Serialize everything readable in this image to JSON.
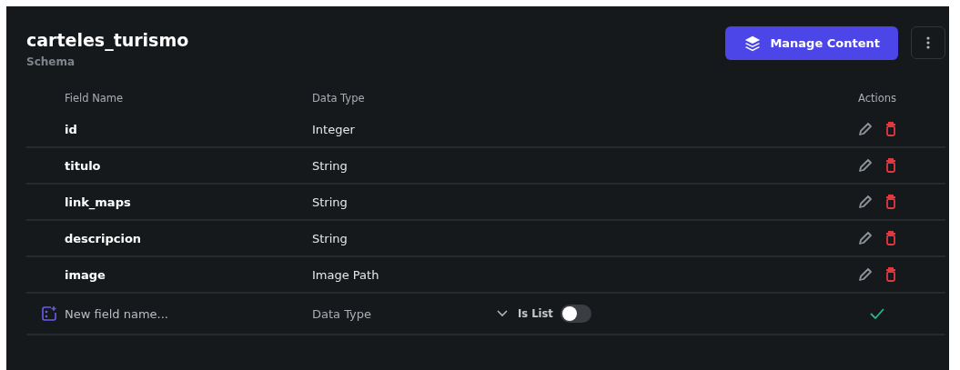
{
  "header": {
    "title": "carteles_turismo",
    "subtitle": "Schema",
    "primary_button": "Manage Content"
  },
  "table": {
    "columns": [
      "Field Name",
      "Data Type",
      "Actions"
    ],
    "rows": [
      {
        "name": "id",
        "type": "Integer"
      },
      {
        "name": "titulo",
        "type": "String"
      },
      {
        "name": "link_maps",
        "type": "String"
      },
      {
        "name": "descripcion",
        "type": "String"
      },
      {
        "name": "image",
        "type": "Image Path"
      }
    ]
  },
  "new_field": {
    "placeholder": "New field name...",
    "type_placeholder": "Data Type",
    "list_label": "Is List",
    "is_list": false
  }
}
